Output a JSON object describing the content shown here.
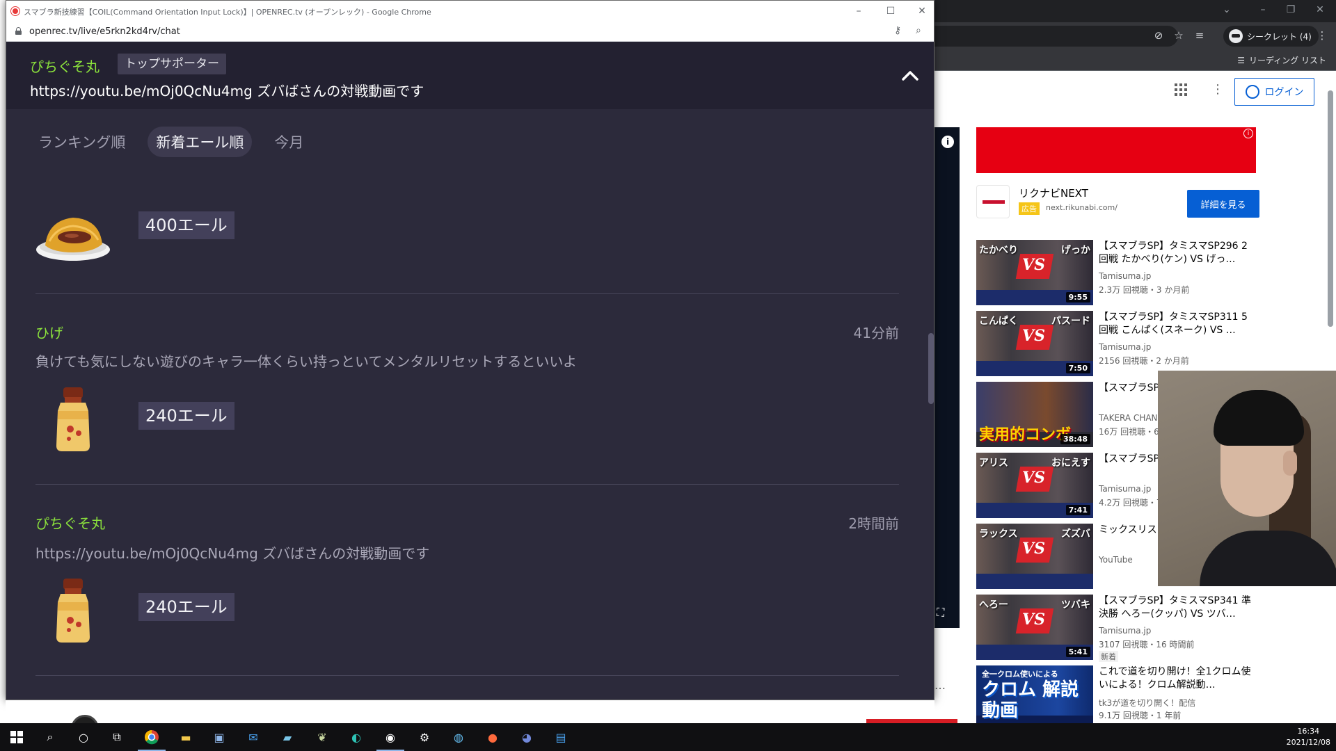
{
  "background_browser": {
    "incognito_label": "シークレット (4)",
    "reading_list_label": "リーディング リスト",
    "login_label": "ログイン"
  },
  "ad": {
    "title": "リクナビNEXT",
    "badge": "広告",
    "domain": "next.rikunabi.com/",
    "cta": "詳細を見る"
  },
  "recommendations": [
    {
      "title": "【スマブラSP】タミスマSP296 2回戦 たかべり(ケン) VS げっ…",
      "channel": "Tamisuma.jp",
      "meta": "2.3万 回視聴・3 か月前",
      "duration": "9:55",
      "thumb_left": "たかべり",
      "thumb_right": "げっか",
      "new_label": ""
    },
    {
      "title": "【スマブラSP】タミスマSP311 5回戦 こんぱく(スネーク) VS …",
      "channel": "Tamisuma.jp",
      "meta": "2156 回視聴・2 か月前",
      "duration": "7:50",
      "thumb_left": "こんぱく",
      "thumb_right": "パスード",
      "new_label": ""
    },
    {
      "title": "【スマブラSP 【実用性重視",
      "channel": "TAKERA CHANN",
      "meta": "16万 回視聴・6",
      "duration": "38:48",
      "thumb_big": "実用的コンボ",
      "new_label": ""
    },
    {
      "title": "【スマブラSP 準決勝 アリス",
      "channel": "Tamisuma.jp",
      "meta": "4.2万 回視聴・7",
      "duration": "7:41",
      "thumb_left": "アリス",
      "thumb_right": "おにえす",
      "new_label": ""
    },
    {
      "title": "ミックスリス",
      "channel": "YouTube",
      "meta": "",
      "duration": "",
      "thumb_left": "ラックス",
      "thumb_right": "ズズバ",
      "new_label": ""
    },
    {
      "title": "【スマブラSP】タミスマSP341 準決勝 へろー(クッパ) VS ツバ…",
      "channel": "Tamisuma.jp",
      "meta": "3107 回視聴・16 時間前",
      "duration": "5:41",
      "thumb_left": "へろー",
      "thumb_right": "ツバキ",
      "new_label": "新着"
    },
    {
      "title": "これで道を切り開け！全1クロム使いによる！クロム解説動…",
      "channel": "tk3が道を切り開く！配信",
      "meta": "9.1万 回視聴・1 年前",
      "duration": "",
      "thumb_small": "全一クロム使いによる",
      "thumb_big": "クロム 解説動画",
      "new_label": ""
    }
  ],
  "popup": {
    "window_title": "スマブラ新技練習【COIL(Command Orientation Input Lock)】| OPENREC.tv (オープンレック) - Google Chrome",
    "url": "openrec.tv/live/e5rkn2kd4rv/chat",
    "pinned": {
      "user": "ぴちぐそ丸",
      "badge": "トップサポーター",
      "message": "https://youtu.be/mOj0QcNu4mg ズバばさんの対戦動画です"
    },
    "tabs": [
      "ランキング順",
      "新着エール順",
      "今月"
    ],
    "active_tab": "新着エール順",
    "feed": [
      {
        "user": "",
        "time": "",
        "message": "",
        "amount": "400エール",
        "gift": "manju-gift"
      },
      {
        "user": "ひげ",
        "time": "41分前",
        "message": "負けても気にしない遊びのキャラ一体くらい持っといてメンタルリセットするといいよ",
        "amount": "240エール",
        "gift": "drink-gift"
      },
      {
        "user": "ぴちぐそ丸",
        "time": "2時間前",
        "message": "https://youtu.be/mOj0QcNu4mg ズバばさんの対戦動画です",
        "amount": "240エール",
        "gift": "drink-gift"
      }
    ]
  },
  "taskbar": {
    "time": "16:34",
    "date": "2021/12/08"
  },
  "colors": {
    "popup_bg": "#2c2a3b",
    "username_green": "#8be23c",
    "youtube_blue": "#065fd4",
    "ad_red": "#e60012"
  }
}
